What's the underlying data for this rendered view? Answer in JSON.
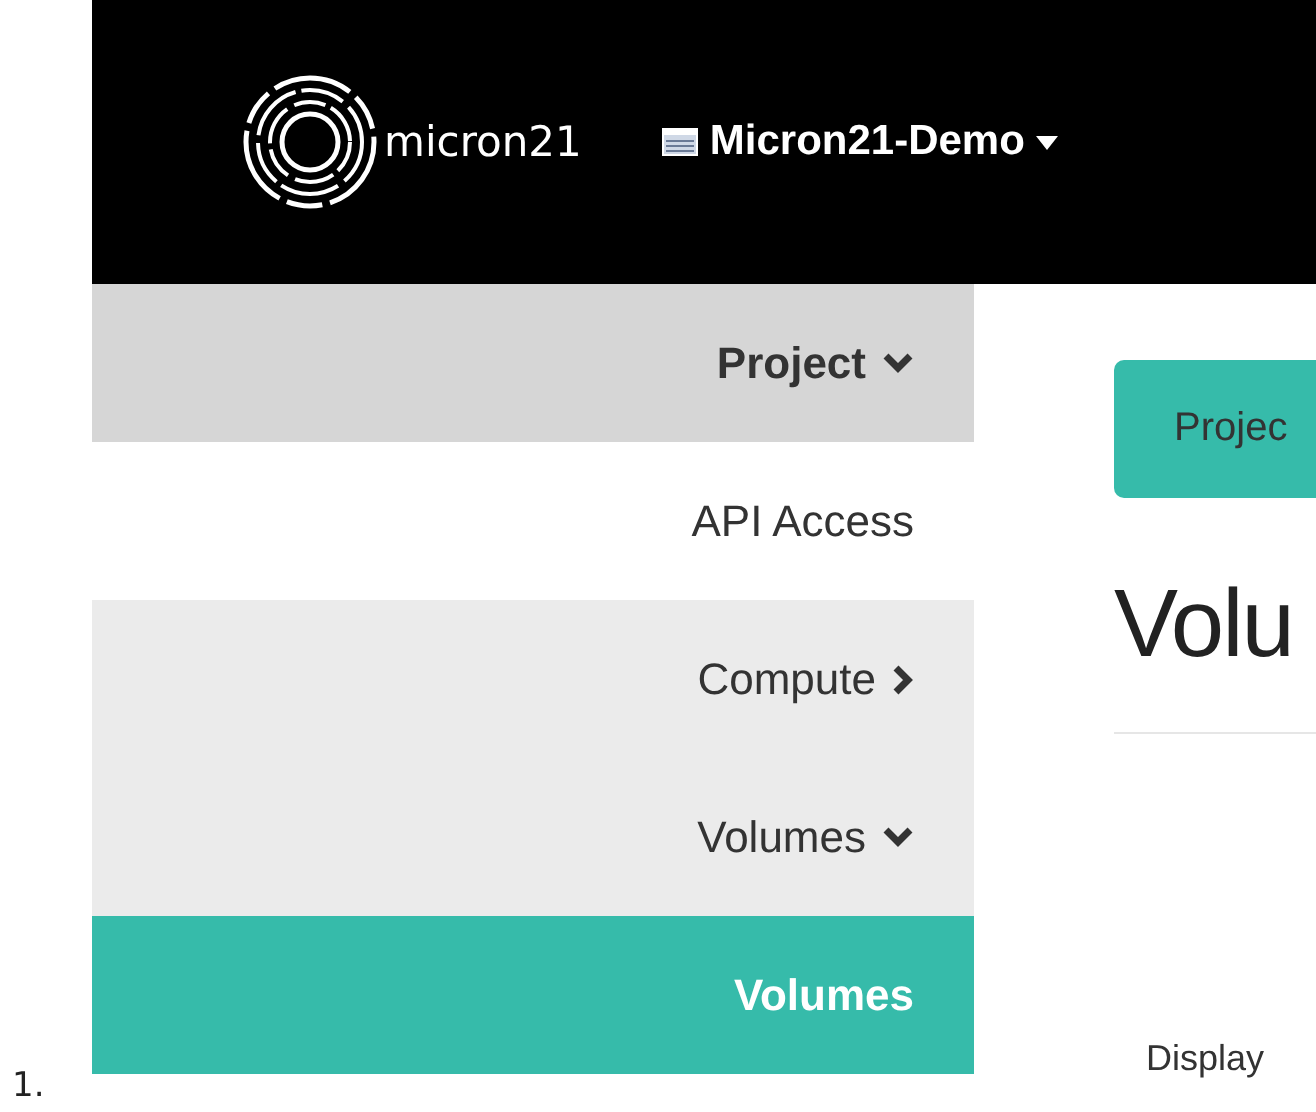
{
  "list_marker": "1.",
  "header": {
    "logo_text": "micron21",
    "project_selector": "Micron21-Demo"
  },
  "sidebar": {
    "items": [
      {
        "label": "Project",
        "kind": "group",
        "expanded": true,
        "selected": false
      },
      {
        "label": "API Access",
        "kind": "link",
        "selected": false
      },
      {
        "label": "Compute",
        "kind": "group",
        "expanded": false,
        "selected": false
      },
      {
        "label": "Volumes",
        "kind": "subgroup",
        "expanded": true,
        "selected": false
      },
      {
        "label": "Volumes",
        "kind": "link",
        "selected": true
      }
    ]
  },
  "content": {
    "breadcrumb": "Projec",
    "heading": "Volu",
    "label": "Display"
  }
}
